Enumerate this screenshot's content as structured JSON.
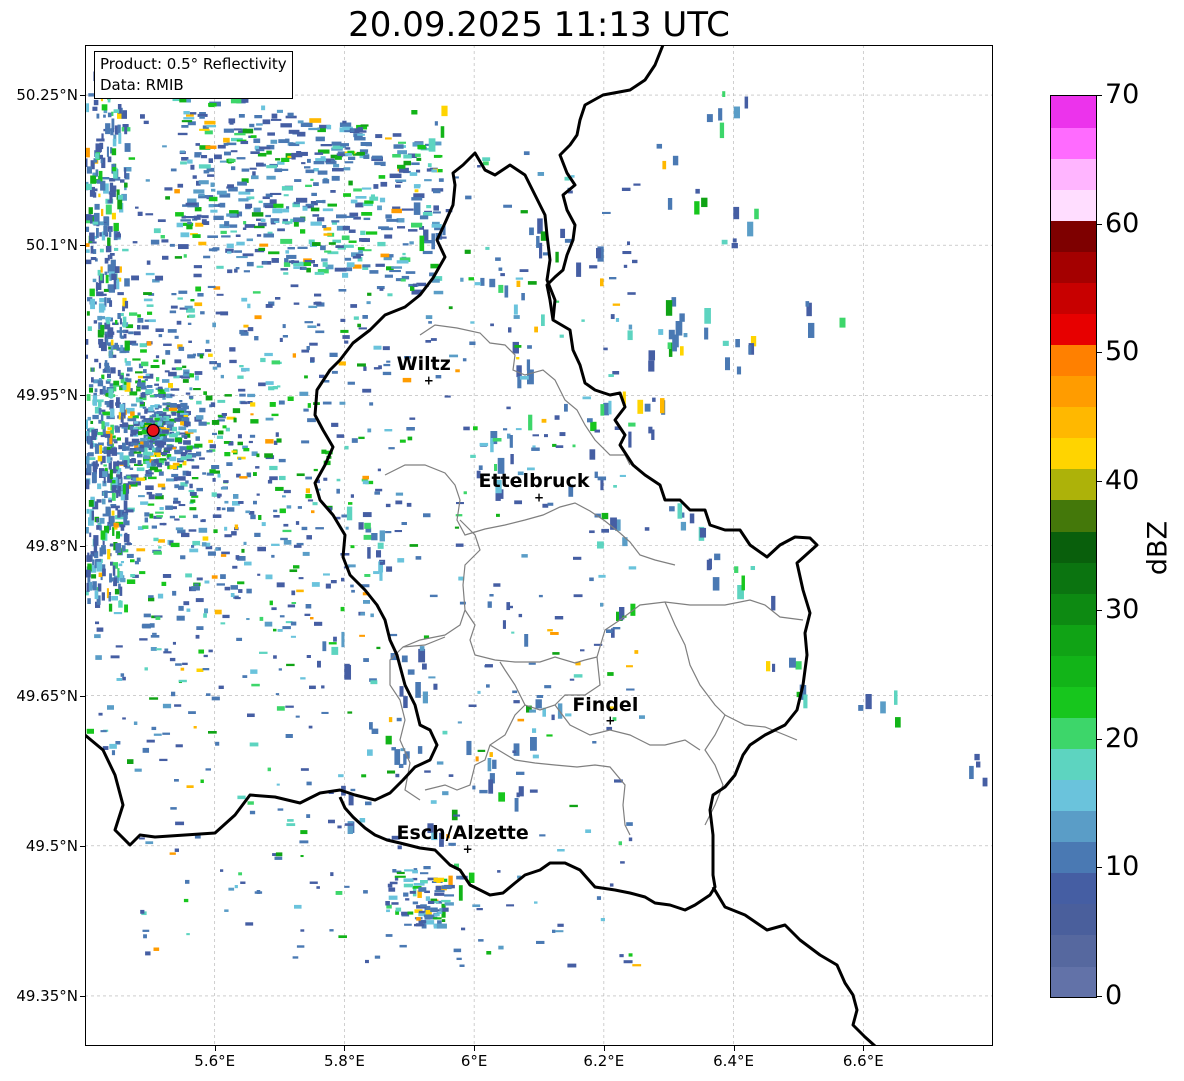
{
  "title": "20.09.2025 11:13 UTC",
  "info_box": {
    "product": "Product: 0.5° Reflectivity",
    "data": "Data: RMIB"
  },
  "y_tick_labels": [
    "50.25°N",
    "50.1°N",
    "49.95°N",
    "49.8°N",
    "49.65°N",
    "49.5°N",
    "49.35°N"
  ],
  "x_tick_labels": [
    "5.6°E",
    "5.8°E",
    "6°E",
    "6.2°E",
    "6.4°E",
    "6.6°E"
  ],
  "colorbar": {
    "label": "dBZ",
    "tick_labels": [
      "0",
      "10",
      "20",
      "30",
      "40",
      "50",
      "60",
      "70"
    ],
    "colors": [
      "#6272a8",
      "#56689f",
      "#4a5f9c",
      "#455ea3",
      "#4a79b3",
      "#5a9dc7",
      "#6ac3dc",
      "#5dd4c0",
      "#3dd66a",
      "#17c61d",
      "#12b418",
      "#10a315",
      "#0d8a12",
      "#0b7410",
      "#095f0c",
      "#44780a",
      "#adb209",
      "#ffd400",
      "#ffb800",
      "#ff9c00",
      "#ff8000",
      "#e70000",
      "#c80000",
      "#a40000",
      "#7e0000",
      "#ffddff",
      "#ffb5ff",
      "#ff6bff",
      "#ec33ec"
    ]
  },
  "cities": [
    {
      "name": "Wiltz",
      "lon": 5.93,
      "lat": 49.965
    },
    {
      "name": "Ettelbruck",
      "lon": 6.1,
      "lat": 49.848
    },
    {
      "name": "Findel",
      "lon": 6.21,
      "lat": 49.625
    },
    {
      "name": "Esch/Alzette",
      "lon": 5.99,
      "lat": 49.497
    }
  ],
  "radar_site": {
    "lon": 5.505,
    "lat": 49.915,
    "color": "#e8131b"
  },
  "map_extent": {
    "lon": [
      5.4,
      6.8
    ],
    "lat": [
      49.3,
      50.3
    ]
  },
  "colors": {
    "border": "#000000",
    "canton": "#7f7f7f",
    "grid": "#b0b0b0"
  }
}
